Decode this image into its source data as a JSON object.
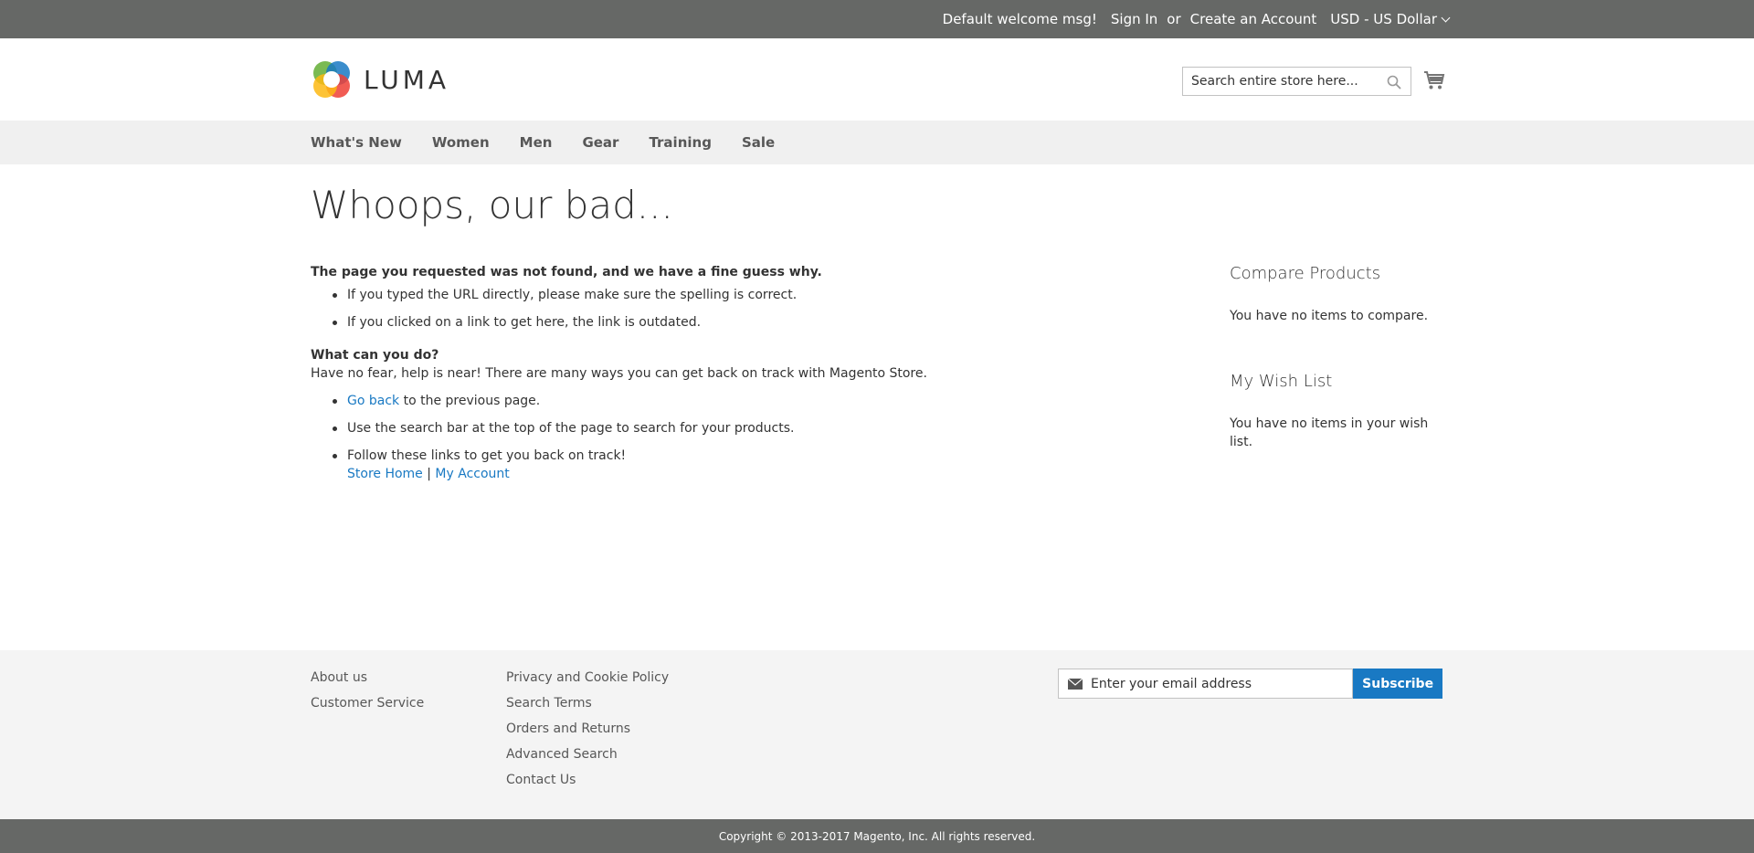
{
  "topbar": {
    "welcome": "Default welcome msg!",
    "sign_in": "Sign In",
    "or": "or",
    "create_account": "Create an Account",
    "currency": "USD - US Dollar"
  },
  "header": {
    "logo_text": "LUMA",
    "search_placeholder": "Search entire store here...",
    "search_value": ""
  },
  "nav": {
    "items": [
      "What's New",
      "Women",
      "Men",
      "Gear",
      "Training",
      "Sale"
    ]
  },
  "main": {
    "title": "Whoops, our bad...",
    "not_found_heading": "The page you requested was not found, and we have a fine guess why.",
    "reasons": [
      "If you typed the URL directly, please make sure the spelling is correct.",
      "If you clicked on a link to get here, the link is outdated."
    ],
    "what_heading": "What can you do?",
    "help_text": "Have no fear, help is near! There are many ways you can get back on track with Magento Store.",
    "go_back_link": "Go back",
    "go_back_rest": " to the previous page.",
    "search_tip": "Use the search bar at the top of the page to search for your products.",
    "follow_links": "Follow these links to get you back on track!",
    "store_home": "Store Home",
    "pipe": "|",
    "my_account": "My Account"
  },
  "sidebar": {
    "compare_title": "Compare Products",
    "compare_text": "You have no items to compare.",
    "wishlist_title": "My Wish List",
    "wishlist_text": "You have no items in your wish list."
  },
  "footer": {
    "col1": [
      "About us",
      "Customer Service"
    ],
    "col2": [
      "Privacy and Cookie Policy",
      "Search Terms",
      "Orders and Returns",
      "Advanced Search",
      "Contact Us"
    ],
    "newsletter_placeholder": "Enter your email address",
    "subscribe": "Subscribe",
    "copyright": "Copyright © 2013-2017 Magento, Inc. All rights reserved."
  },
  "colors": {
    "topbar_bg": "#666866",
    "nav_bg": "#f0f0f0",
    "footer_bg": "#f4f4f4",
    "link": "#1979c3",
    "subscribe_bg": "#1979c3"
  },
  "icons": {
    "logo": "luma-logo-icon",
    "search": "search-icon",
    "cart": "cart-icon",
    "currency_dropdown": "chevron-down-icon",
    "email": "envelope-icon"
  }
}
